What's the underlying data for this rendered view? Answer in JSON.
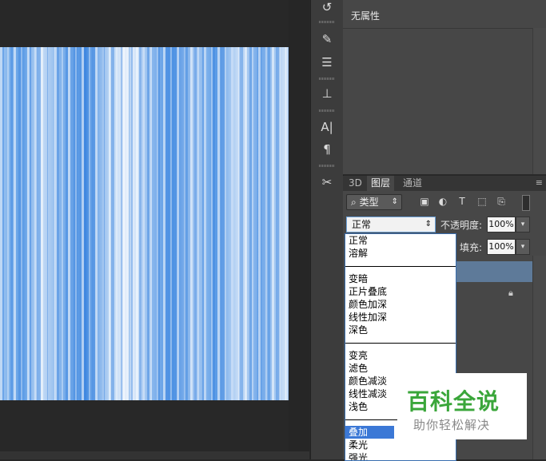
{
  "properties_panel": {
    "title": "无属性"
  },
  "layers_panel": {
    "tabs": [
      {
        "label": "3D",
        "active": false
      },
      {
        "label": "图层",
        "active": true
      },
      {
        "label": "通道",
        "active": false
      }
    ],
    "menu_icon": "≡",
    "filter": {
      "icon": "search-icon",
      "value": "类型",
      "arrow": "⇕"
    },
    "filter_icons": [
      "image-icon",
      "adjustment-icon",
      "type-icon",
      "shape-icon",
      "smart-object-icon"
    ],
    "blend_mode": {
      "value": "正常",
      "arrow": "⇕"
    },
    "opacity": {
      "label": "不透明度:",
      "value": "100%"
    },
    "fill": {
      "label": "填充:",
      "value": "100%"
    }
  },
  "blend_list": {
    "groups": [
      [
        "正常",
        "溶解"
      ],
      [
        "变暗",
        "正片叠底",
        "颜色加深",
        "线性加深",
        "深色"
      ],
      [
        "变亮",
        "滤色",
        "颜色减淡",
        "线性减淡",
        "浅色"
      ],
      [
        "叠加",
        "柔光",
        "强光"
      ]
    ],
    "selected": "叠加"
  },
  "tool_strip": {
    "icons": [
      "history-icon",
      "brush-preset-icon",
      "adjustments-icon",
      "clone-source-icon",
      "character-icon",
      "paragraph-icon",
      "tool-presets-icon"
    ]
  },
  "watermark": {
    "title": "百科全说",
    "subtitle": "助你轻松解决"
  },
  "colors": {
    "canvas_blue": "#5c9ce6",
    "selection_blue": "#3b78d6",
    "layer_selected": "#5e7a99",
    "watermark_green": "#3aa63a"
  }
}
